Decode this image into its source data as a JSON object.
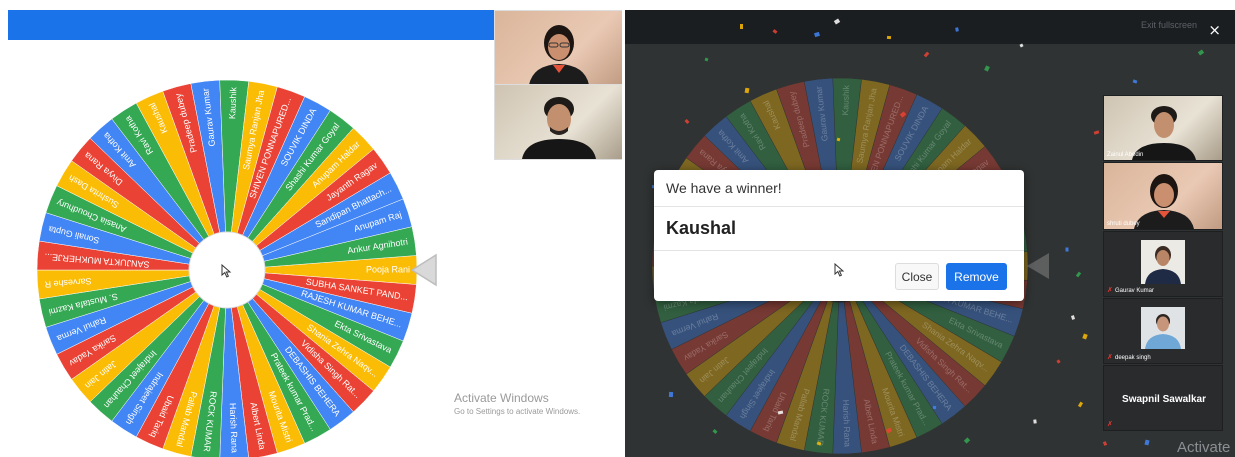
{
  "wheel": {
    "colors": {
      "red": "#ea4335",
      "blue": "#4285f4",
      "green": "#34a853",
      "yellow": "#fbbc05",
      "pointer": "#d6d6d6",
      "label": "#ffffff"
    },
    "segments": [
      {
        "label": "Pooja Rani",
        "color": "yellow"
      },
      {
        "label": "SUBHA SANKET PAND...",
        "color": "red"
      },
      {
        "label": "RAJESH KUMAR BEHE...",
        "color": "blue"
      },
      {
        "label": "Ekta Srivastava",
        "color": "green"
      },
      {
        "label": "Shania Zehra Naqv...",
        "color": "yellow"
      },
      {
        "label": "Vidisha Singh Rat...",
        "color": "red"
      },
      {
        "label": "DEBASHIS BEHERA",
        "color": "blue"
      },
      {
        "label": "Prateek kumar Prad...",
        "color": "green"
      },
      {
        "label": "Mourita Mistri",
        "color": "yellow"
      },
      {
        "label": "Albert Linda",
        "color": "red"
      },
      {
        "label": "Harish Rana",
        "color": "blue"
      },
      {
        "label": "ROCK KUMAR",
        "color": "green"
      },
      {
        "label": "Pallab Mandal",
        "color": "yellow"
      },
      {
        "label": "Ubaid Tariq",
        "color": "red"
      },
      {
        "label": "Indrajeet Singh",
        "color": "blue"
      },
      {
        "label": "Indrajeet Chauhan",
        "color": "green"
      },
      {
        "label": "Jatin Jain",
        "color": "yellow"
      },
      {
        "label": "Sarika Yadav",
        "color": "red"
      },
      {
        "label": "Rahul Verma",
        "color": "blue"
      },
      {
        "label": "S. Mustafa Kazmi",
        "color": "green"
      },
      {
        "label": "Sarveshe R",
        "color": "yellow"
      },
      {
        "label": "SANJUKTA MUKHERJE...",
        "color": "red"
      },
      {
        "label": "Sonali Gupta",
        "color": "blue"
      },
      {
        "label": "Anasia Choudhury",
        "color": "green"
      },
      {
        "label": "Sushrita Dash",
        "color": "yellow"
      },
      {
        "label": "Divya Rana",
        "color": "red"
      },
      {
        "label": "Amit Kotha",
        "color": "blue"
      },
      {
        "label": "Ravi Kotha",
        "color": "green"
      },
      {
        "label": "Kaushal",
        "color": "yellow"
      },
      {
        "label": "Pradeep dubey",
        "color": "red"
      },
      {
        "label": "Gaurav Kumar",
        "color": "blue"
      },
      {
        "label": "Kaushik",
        "color": "green"
      },
      {
        "label": "Saumya Ranjan Jha",
        "color": "yellow"
      },
      {
        "label": "SHIVEN PONNAPURED...",
        "color": "red"
      },
      {
        "label": "SOUVIK DINDA",
        "color": "blue"
      },
      {
        "label": "Shashi Kumar Goyal",
        "color": "green"
      },
      {
        "label": "Anupam Haldar",
        "color": "yellow"
      },
      {
        "label": "Jayanth Ragav",
        "color": "red"
      },
      {
        "label": "Sandipan Bhattach...",
        "color": "blue"
      },
      {
        "label": "Anupam Raj",
        "color": "blue"
      },
      {
        "label": "Ankur Agnihotri",
        "color": "green"
      }
    ]
  },
  "watermark": {
    "title": "Activate Windows",
    "subtitle": "Go to Settings to activate Windows."
  },
  "right_panel": {
    "fullscreen_label": "Exit fullscreen",
    "close_icon": "×",
    "modal": {
      "title": "We have a winner!",
      "winner": "Kaushal",
      "close_button": "Close",
      "remove_button": "Remove",
      "accent": "#1a73e8"
    },
    "participants": [
      {
        "name": "Zainul Abedin",
        "muted": false
      },
      {
        "name": "shruti dubey",
        "muted": false
      },
      {
        "name": "Gaurav Kumar",
        "muted": true
      },
      {
        "name": "deepak singh",
        "muted": true
      },
      {
        "name": "Swapnil Sawalkar",
        "muted": true
      }
    ],
    "watermark": "Activate"
  }
}
